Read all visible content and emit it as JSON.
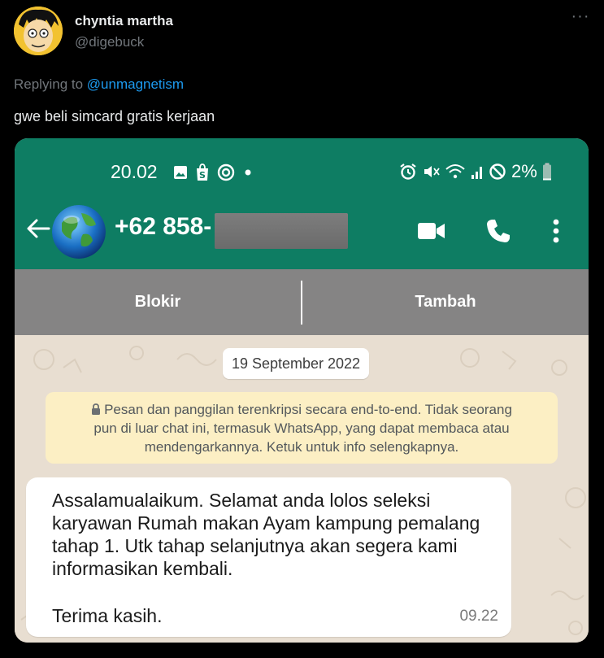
{
  "tweet": {
    "author_name": "chyntia martha",
    "author_handle": "@digebuck",
    "more_label": "···",
    "replying_prefix": "Replying to ",
    "replying_mention": "@unmagnetism",
    "text": "gwe beli simcard gratis kerjaan"
  },
  "phone": {
    "status_time": "20.02",
    "battery_percent": "2%",
    "status_icons_left": [
      "gallery-icon",
      "shopping-bag-icon",
      "swirl-notification-icon",
      "dot-icon"
    ],
    "status_icons_right": [
      "alarm-icon",
      "mute-icon",
      "wifi-icon",
      "signal-icon",
      "do-not-disturb-icon",
      "battery-icon"
    ]
  },
  "whatsapp": {
    "contact_number": "+62 858-",
    "header_icons": [
      "back-arrow-icon",
      "video-call-icon",
      "voice-call-icon",
      "more-vertical-icon"
    ],
    "actions": {
      "block_label": "Blokir",
      "add_label": "Tambah"
    },
    "date_chip": "19 September 2022",
    "encryption_notice": {
      "lines": [
        "Pesan dan panggilan terenkripsi secara end-to-end. Tidak seorang",
        "pun di luar chat ini, termasuk WhatsApp, yang dapat membaca atau",
        "mendengarkannya. Ketuk untuk info selengkapnya."
      ]
    },
    "message": {
      "lines": [
        "Assalamualaikum. Selamat anda lolos seleksi",
        "karyawan Rumah makan Ayam kampung pemalang",
        "tahap 1. Utk tahap selanjutnya akan segera kami",
        "informasikan kembali."
      ],
      "closing": "Terima kasih.",
      "time": "09.22"
    }
  },
  "colors": {
    "background": "#000000",
    "whatsapp_green": "#0e7d63",
    "action_bar_gray": "#858484",
    "chat_wallpaper": "#e8ded1",
    "notice_yellow": "#fcefc4",
    "mention_blue": "#1d9bf0",
    "muted_gray": "#71767b"
  }
}
